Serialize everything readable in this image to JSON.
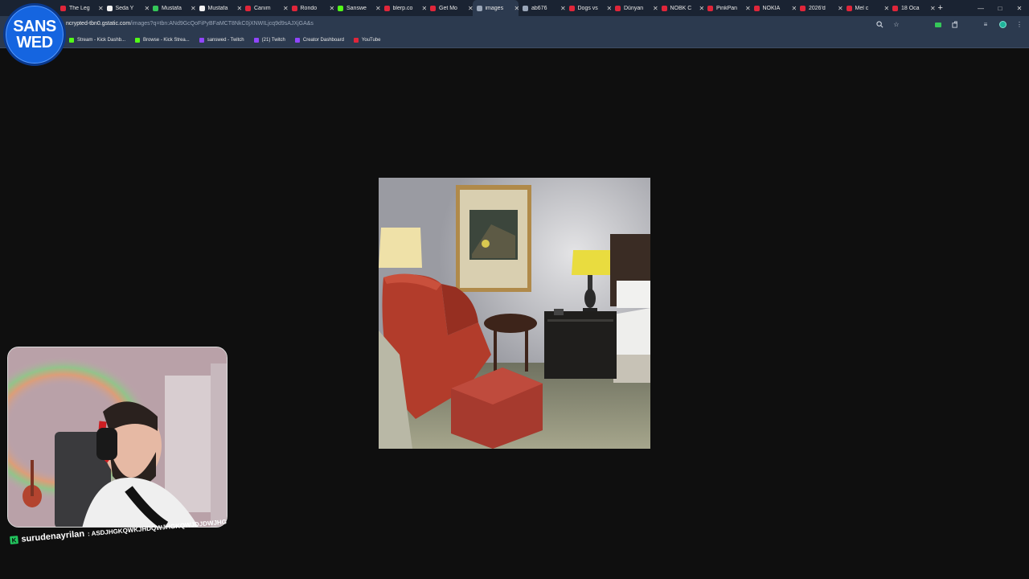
{
  "channel_logo": {
    "line1": "SANS",
    "line2": "WED"
  },
  "tabs": [
    {
      "title": "The Leg",
      "color": "#e0263a",
      "active": false
    },
    {
      "title": "Seda Y",
      "color": "#f2f2f2",
      "active": false
    },
    {
      "title": "Mustafa",
      "color": "#35c759",
      "active": false
    },
    {
      "title": "Mustafa",
      "color": "#f2f2f2",
      "active": false
    },
    {
      "title": "Canım",
      "color": "#e0263a",
      "active": false
    },
    {
      "title": "Rondo",
      "color": "#e0263a",
      "active": false
    },
    {
      "title": "Sanswe",
      "color": "#53fc18",
      "active": false
    },
    {
      "title": "blerp.co",
      "color": "#e0263a",
      "active": false
    },
    {
      "title": "Get Mo",
      "color": "#e0263a",
      "active": false
    },
    {
      "title": "images",
      "color": "#9aa6b8",
      "active": true
    },
    {
      "title": "ab676",
      "color": "#9aa6b8",
      "active": false
    },
    {
      "title": "Dogs vs",
      "color": "#e0263a",
      "active": false
    },
    {
      "title": "Dünyan",
      "color": "#e0263a",
      "active": false
    },
    {
      "title": "NOBK C",
      "color": "#e0263a",
      "active": false
    },
    {
      "title": "PinkPan",
      "color": "#e0263a",
      "active": false
    },
    {
      "title": "NOKIA",
      "color": "#e0263a",
      "active": false
    },
    {
      "title": "2026'd",
      "color": "#e0263a",
      "active": false
    },
    {
      "title": "Mel c",
      "color": "#e0263a",
      "active": false
    },
    {
      "title": "18 Oca",
      "color": "#e0263a",
      "active": false
    }
  ],
  "address_bar": {
    "url_host": "ncrypted-tbn0.gstatic.com",
    "url_path": "/images?q=tbn:ANd9GcQoFiPyBFaMCT8NkC0jXNWILjcq9d9sAJXjGA&s"
  },
  "bookmarks": [
    {
      "label": "Stream - Kick Dashb...",
      "color": "#53fc18"
    },
    {
      "label": "Browse - Kick Strea...",
      "color": "#53fc18"
    },
    {
      "label": "sanswed - Twitch",
      "color": "#9146ff"
    },
    {
      "label": "(21) Twitch",
      "color": "#9146ff"
    },
    {
      "label": "Creator Dashboard",
      "color": "#9146ff"
    },
    {
      "label": "YouTube",
      "color": "#e0263a"
    }
  ],
  "chat": {
    "username": "surudenayrilan",
    "message": ": ASDJHGKQWKJHDQWJHGKQWJDJDWJHG"
  }
}
